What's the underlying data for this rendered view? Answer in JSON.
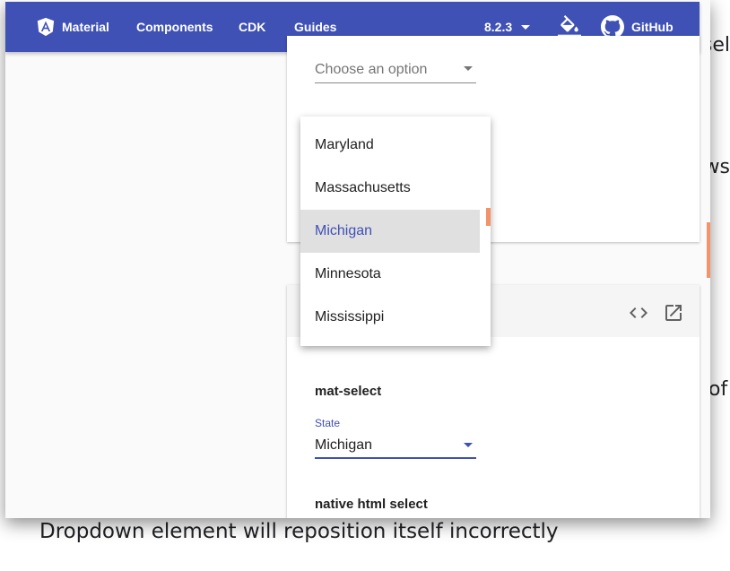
{
  "background": {
    "caption": "Dropdown element will reposition itself incorrectly",
    "fragments": {
      "sel": "sel",
      "ws": "ws",
      "of": "of"
    }
  },
  "toolbar": {
    "brand": "Material",
    "nav": [
      "Components",
      "CDK",
      "Guides"
    ],
    "version": "8.2.3",
    "github": "GitHub",
    "color": "#3f51b5"
  },
  "top_card": {
    "select_placeholder": "Choose an option"
  },
  "dropdown": {
    "options": [
      "Maryland",
      "Massachusetts",
      "Michigan",
      "Minnesota",
      "Mississippi"
    ],
    "selected": "Michigan"
  },
  "bottom_card": {
    "mat_select_title": "mat-select",
    "state_label": "State",
    "state_value": "Michigan",
    "native_select_title": "native html select"
  },
  "icons": [
    "angular-icon",
    "chevron-down-icon",
    "format-color-fill-icon",
    "github-icon",
    "code-icon",
    "open-in-new-icon"
  ]
}
